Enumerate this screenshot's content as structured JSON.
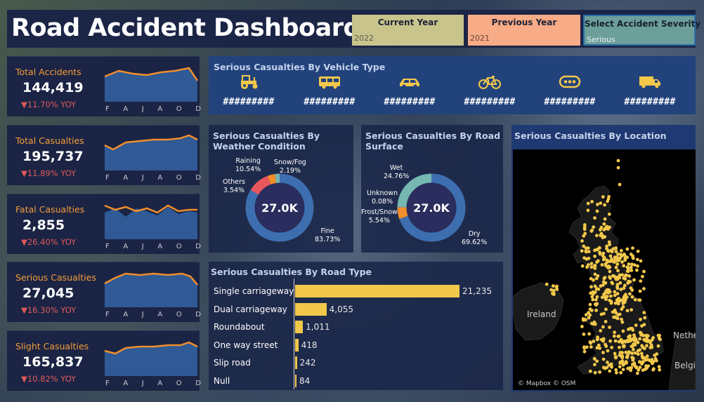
{
  "header": {
    "title": "Road Accident Dashboard",
    "filters": {
      "current_year": {
        "label": "Current Year",
        "value": "2022"
      },
      "previous_year": {
        "label": "Previous Year",
        "value": "2021"
      },
      "severity": {
        "label": "Select Accident Severity",
        "value": "Serious"
      }
    }
  },
  "kpis": [
    {
      "label": "Total Accidents",
      "value": "144,419",
      "yoy": "▼11.70% YOY"
    },
    {
      "label": "Total Casualties",
      "value": "195,737",
      "yoy": "▼11.89% YOY"
    },
    {
      "label": "Fatal Casualties",
      "value": "2,855",
      "yoy": "▼26.40% YOY"
    },
    {
      "label": "Serious Casualties",
      "value": "27,045",
      "yoy": "▼16.30% YOY"
    },
    {
      "label": "Slight Casualties",
      "value": "165,837",
      "yoy": "▼10.82% YOY"
    }
  ],
  "months": [
    "F",
    "A",
    "J",
    "A",
    "O",
    "D"
  ],
  "vehicle": {
    "title": "Serious Casualties By Vehicle Type",
    "items": [
      {
        "icon": "tractor-icon",
        "value": "#########"
      },
      {
        "icon": "bus-icon",
        "value": "#########"
      },
      {
        "icon": "car-icon",
        "value": "#########"
      },
      {
        "icon": "bicycle-icon",
        "value": "#########"
      },
      {
        "icon": "other-vehicle-icon",
        "value": "#########"
      },
      {
        "icon": "truck-icon",
        "value": "#########"
      }
    ]
  },
  "weather": {
    "title": "Serious Casualties By Weather Condition",
    "center": "27.0K",
    "labels": {
      "raining": {
        "name": "Raining",
        "pct": "10.54%"
      },
      "snow": {
        "name": "Snow/Fog",
        "pct": "2.19%"
      },
      "others": {
        "name": "Others",
        "pct": "3.54%"
      },
      "fine": {
        "name": "Fine",
        "pct": "83.73%"
      }
    }
  },
  "surface": {
    "title": "Serious Casualties By Road Surface",
    "center": "27.0K",
    "labels": {
      "wet": {
        "name": "Wet",
        "pct": "24.76%"
      },
      "unknown": {
        "name": "Unknown",
        "pct": "0.08%"
      },
      "frost": {
        "name": "Frost/Snow",
        "pct": "5.54%"
      },
      "dry": {
        "name": "Dry",
        "pct": "69.62%"
      }
    }
  },
  "location": {
    "title": "Serious Casualties By Location",
    "labels": {
      "ireland": "Ireland",
      "netherlands": "Nethe",
      "belgium": "Belgi"
    },
    "attribution": "© Mapbox © OSM"
  },
  "chart_data": [
    {
      "type": "bar",
      "title": "Serious Casualties By Road Type",
      "categories": [
        "Single carriageway",
        "Dual carriageway",
        "Roundabout",
        "One way street",
        "Slip road",
        "Null"
      ],
      "values": [
        21235,
        4055,
        1011,
        418,
        242,
        84
      ],
      "value_labels": [
        "21,235",
        "4,055",
        "1,011",
        "418",
        "242",
        "84"
      ],
      "orientation": "horizontal",
      "color": "#f2c84b"
    },
    {
      "type": "pie",
      "title": "Serious Casualties By Weather Condition",
      "categories": [
        "Fine",
        "Raining",
        "Others",
        "Snow/Fog"
      ],
      "values": [
        83.73,
        10.54,
        3.54,
        2.19
      ],
      "colors": [
        "#3d6eb0",
        "#e8575d",
        "#f28e2b",
        "#76b7b2"
      ]
    },
    {
      "type": "pie",
      "title": "Serious Casualties By Road Surface",
      "categories": [
        "Dry",
        "Frost/Snow",
        "Unknown",
        "Wet"
      ],
      "values": [
        69.62,
        5.54,
        0.08,
        24.76
      ],
      "colors": [
        "#3d6eb0",
        "#f28e2b",
        "#e8575d",
        "#76b7b2"
      ]
    }
  ],
  "colors": {
    "kpi_label": "#f39c3a",
    "yoy_down": "#e05a5a",
    "bar": "#f2c84b",
    "sparkline_area": "#2f5a96",
    "sparkline_line": "#f28e2b"
  }
}
